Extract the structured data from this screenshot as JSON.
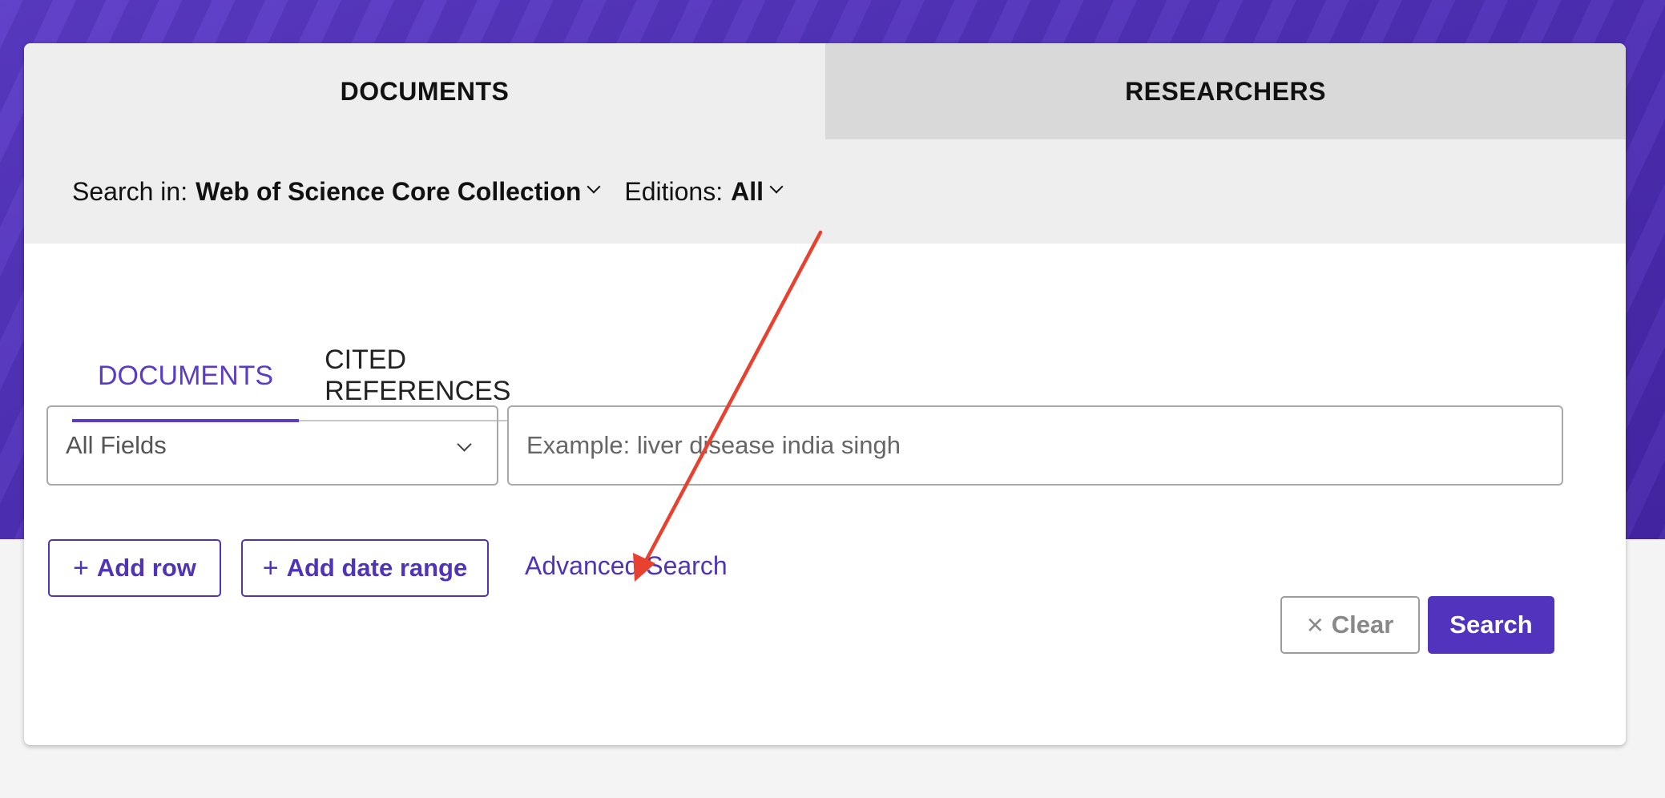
{
  "top_tabs": [
    {
      "label": "DOCUMENTS",
      "active": true
    },
    {
      "label": "RESEARCHERS",
      "active": false
    }
  ],
  "search_in": {
    "label": "Search in:",
    "value": "Web of Science Core Collection",
    "editions_label": "Editions:",
    "editions_value": "All"
  },
  "sub_tabs": [
    {
      "label": "DOCUMENTS",
      "active": true
    },
    {
      "label": "CITED REFERENCES",
      "active": false
    }
  ],
  "query": {
    "field": "All Fields",
    "placeholder": "Example: liver disease india singh",
    "value": ""
  },
  "actions": {
    "add_row": "Add row",
    "add_date_range": "Add date range",
    "advanced_search": "Advanced Search",
    "clear": "Clear",
    "search": "Search"
  },
  "colors": {
    "brand": "#5133bd",
    "annotation_arrow": "#e8412f"
  }
}
